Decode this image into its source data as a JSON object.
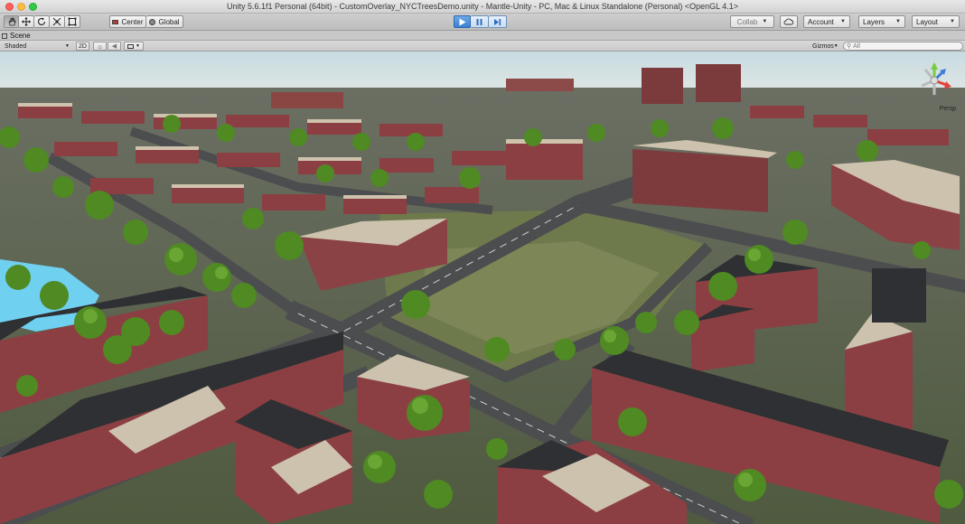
{
  "window": {
    "title": "Unity 5.6.1f1 Personal (64bit) - CustomOverlay_NYCTreesDemo.unity - Mantle-Unity - PC, Mac & Linux Standalone (Personal) <OpenGL 4.1>"
  },
  "toolbar": {
    "tools": [
      "hand-tool",
      "move-tool",
      "rotate-tool",
      "scale-tool",
      "rect-tool"
    ],
    "pivot_label": "Center",
    "space_label": "Global",
    "collab_label": "Collab",
    "account_label": "Account",
    "layers_label": "Layers",
    "layout_label": "Layout"
  },
  "scene_tab": {
    "label": "Scene"
  },
  "scene_toolbar": {
    "shading_mode": "Shaded",
    "mode_2d_label": "2D",
    "gizmos_label": "Gizmos",
    "search_placeholder": "All"
  },
  "viewport": {
    "projection_label": "Persp",
    "colors": {
      "sky": "#c7dbe2",
      "ground": "#5d6a4a",
      "road": "#4b4d4f",
      "brick": "#8c3f42",
      "roof_dark": "#2f3033",
      "roof_light": "#cfc3ad",
      "tree": "#4f8a23",
      "water": "#6fd0f0"
    }
  }
}
